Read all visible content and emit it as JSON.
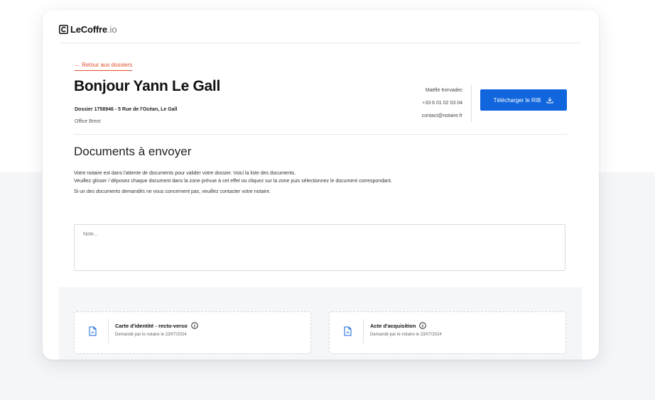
{
  "brand": {
    "name": "LeCoffre",
    "tld": ".io"
  },
  "back_link": "← Retour aux dossiers",
  "greeting": "Bonjour Yann Le Gall",
  "dossier_line": "Dossier 1758946 - 5 Rue de l'Océan, Le Gall",
  "office": "Office Brest",
  "contact": {
    "name": "Maëlle Kervadec",
    "phone": "+33 6 01 02 03 04",
    "email": "contact@notaire.fr"
  },
  "rib_button": "Télécharger le RIB",
  "documents_title": "Documents à envoyer",
  "instructions": {
    "line1": "Votre notaire est dans l'attente de documents pour valider votre dossier. Voici la liste des documents.",
    "line2": "Veuillez glisser / déposez chaque document dans la zone prévue à cet effet ou cliquez sur la zone puis sélectionnez le document correspondant.",
    "line3": "Si un des documents demandés ne vous concernent pas, veuillez contacter votre notaire."
  },
  "note": {
    "placeholder": "Note..."
  },
  "documents": [
    {
      "name": "Carte d'identité - recto-verso",
      "requested": "Demandé par le notaire le 23/07/2024"
    },
    {
      "name": "Acte d'acquisition",
      "requested": "Demandé par le notaire le 23/07/2024"
    }
  ],
  "colors": {
    "accent": "#1166dd",
    "link": "#e2502d",
    "band_background": "#f5f6f8"
  },
  "icons": [
    "logo-icon",
    "download-icon",
    "file-icon",
    "info-icon"
  ]
}
